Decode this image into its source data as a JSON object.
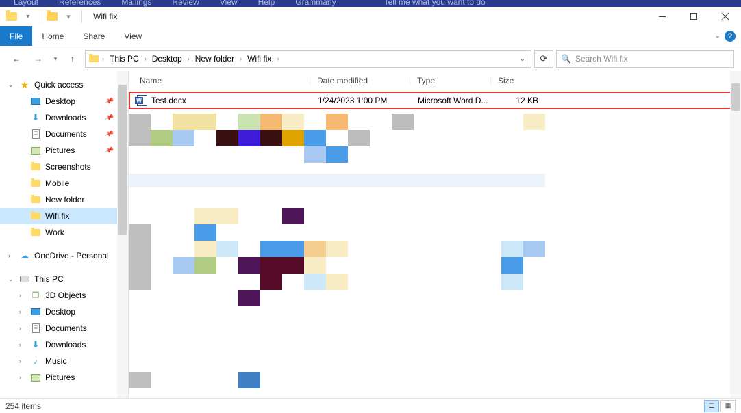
{
  "word_menu": [
    "Layout",
    "References",
    "Mailings",
    "Review",
    "View",
    "Help",
    "Grammarly",
    "Tell me what you want to do"
  ],
  "window": {
    "title": "Wifi fix"
  },
  "ribbon": {
    "file": "File",
    "tabs": [
      "Home",
      "Share",
      "View"
    ]
  },
  "breadcrumb": [
    "This PC",
    "Desktop",
    "New folder",
    "Wifi fix"
  ],
  "search": {
    "placeholder": "Search Wifi fix"
  },
  "sidebar": {
    "quick_access": {
      "label": "Quick access"
    },
    "qa_items": [
      {
        "label": "Desktop",
        "icon": "desktop",
        "pinned": true
      },
      {
        "label": "Downloads",
        "icon": "download",
        "pinned": true
      },
      {
        "label": "Documents",
        "icon": "document",
        "pinned": true
      },
      {
        "label": "Pictures",
        "icon": "picture",
        "pinned": true
      },
      {
        "label": "Screenshots",
        "icon": "folder",
        "pinned": false
      },
      {
        "label": "Mobile",
        "icon": "folder",
        "pinned": false
      },
      {
        "label": "New folder",
        "icon": "folder",
        "pinned": false
      },
      {
        "label": "Wifi fix",
        "icon": "folder",
        "pinned": false,
        "selected": true
      },
      {
        "label": "Work",
        "icon": "folder",
        "pinned": false
      }
    ],
    "onedrive": {
      "label": "OneDrive - Personal"
    },
    "this_pc": {
      "label": "This PC"
    },
    "pc_items": [
      {
        "label": "3D Objects",
        "icon": "cube"
      },
      {
        "label": "Desktop",
        "icon": "desktop"
      },
      {
        "label": "Documents",
        "icon": "document"
      },
      {
        "label": "Downloads",
        "icon": "download"
      },
      {
        "label": "Music",
        "icon": "music"
      },
      {
        "label": "Pictures",
        "icon": "picture"
      }
    ]
  },
  "columns": {
    "name": "Name",
    "date": "Date modified",
    "type": "Type",
    "size": "Size"
  },
  "file": {
    "name": "Test.docx",
    "date": "1/24/2023 1:00 PM",
    "type": "Microsoft Word D...",
    "size": "12 KB"
  },
  "status": {
    "count_label": "254 items"
  },
  "blur_colors": {
    "rows": [
      [
        "#bfbfbf",
        "",
        "#f1e2a3",
        "#f1e2a3",
        "",
        "#cbe3b1",
        "#f5b971",
        "#f7ecc4",
        "",
        "#f5b971",
        "",
        "",
        "#bdbdbd",
        "",
        "",
        "",
        "",
        "",
        "#f7ecc4"
      ],
      [
        "#bfbfbf",
        "#b0cc82",
        "#a8caf2",
        "",
        "#3a1010",
        "#3f1cd9",
        "#3a1010",
        "#e0a300",
        "#4a9be8",
        "",
        "#bdbdbd",
        "",
        "",
        "",
        "",
        "",
        "",
        "",
        ""
      ],
      [
        "",
        "",
        "",
        "",
        "",
        "",
        "",
        "",
        "#a8caf2",
        "#4a9be8",
        "",
        "",
        "",
        "",
        "",
        "",
        "",
        "",
        ""
      ]
    ],
    "wide_band": "#ecf3fb",
    "rows2": [
      [
        "",
        "",
        "",
        "#f7ecc4",
        "#f7ecc4",
        "",
        "",
        "#4d1457",
        "",
        "",
        "",
        "",
        "",
        "",
        "",
        "",
        "",
        "",
        ""
      ],
      [
        "#bfbfbf",
        "",
        "",
        "#4a9be8",
        "",
        "",
        "",
        "",
        "",
        "",
        "",
        "",
        "",
        "",
        "",
        "",
        "",
        "",
        ""
      ],
      [
        "#bfbfbf",
        "",
        "",
        "#f7ecc4",
        "#cde9f9",
        "",
        "#4a9be8",
        "#4a9be8",
        "#f5cd8f",
        "#f7ecc4",
        "",
        "",
        "",
        "",
        "",
        "",
        "",
        "#cde9f9",
        "#a8caf2"
      ],
      [
        "#bfbfbf",
        "",
        "#a8caf2",
        "#b0cc82",
        "",
        "#4d1457",
        "#560c28",
        "#560c28",
        "#f7ecc4",
        "",
        "",
        "",
        "",
        "",
        "",
        "",
        "",
        "#4a9be8",
        ""
      ],
      [
        "#bfbfbf",
        "",
        "",
        "",
        "",
        "",
        "#560c28",
        "",
        "#cde9f9",
        "#f7ecc4",
        "",
        "",
        "",
        "",
        "",
        "",
        "",
        "#cde9f9",
        ""
      ],
      [
        "",
        "",
        "",
        "",
        "",
        "#4d1457",
        "",
        "",
        "",
        "",
        "",
        "",
        "",
        "",
        "",
        "",
        "",
        "",
        ""
      ]
    ],
    "rows3": [
      [
        "#bfbfbf",
        "",
        "",
        "",
        "",
        "#3f7fc4",
        "",
        "",
        "",
        "",
        "",
        "",
        "",
        "",
        "",
        "",
        "",
        "",
        ""
      ]
    ]
  }
}
